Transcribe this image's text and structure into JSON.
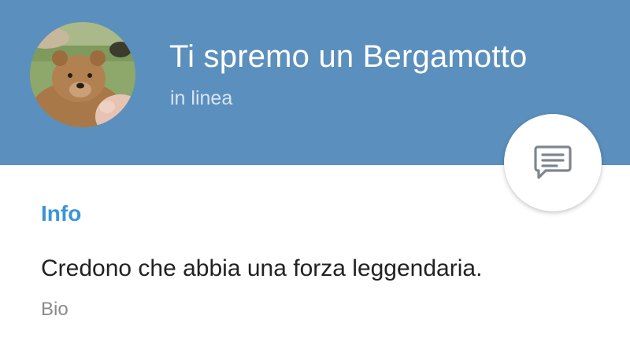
{
  "header": {
    "title": "Ti spremo un Bergamotto",
    "status": "in linea",
    "avatar_icon": "profile-photo-bear",
    "background_color": "#5b8fbd"
  },
  "fab": {
    "icon": "message-icon"
  },
  "info": {
    "section_title": "Info",
    "bio_text": "Credono che abbia una forza leggendaria.",
    "bio_label": "Bio",
    "accent_color": "#3a95d5"
  }
}
